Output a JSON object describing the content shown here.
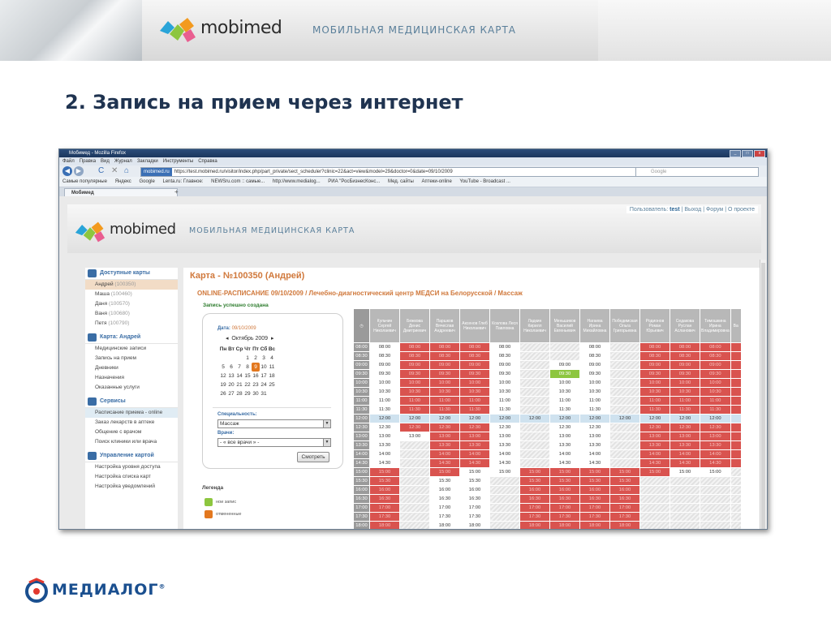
{
  "banner": {
    "brand": "mobimed",
    "tagline": "МОБИЛЬНАЯ МЕДИЦИНСКАЯ КАРТА",
    "logo_icon": "mobimed-logo-icon"
  },
  "slide_title": "2. Запись на прием через интернет",
  "browser": {
    "window_title": "Мобимед - Mozilla Firefox",
    "menu": [
      "Файл",
      "Правка",
      "Вид",
      "Журнал",
      "Закладки",
      "Инструменты",
      "Справка"
    ],
    "url_host": "mobimed.ru",
    "url": "https://test.mobimed.ru/visitor/index.php/part_private/sect_scheduler?clinic=22&act=view&model=29&doctor=0&date=09/10/2009",
    "search_placeholder": "Google",
    "bookmarks": [
      "Самые популярные",
      "Яндекс",
      "Google",
      "Lenta.ru: Главное:",
      "NEWSru.com :: самые...",
      "http://www.medialog...",
      "РИА \"РосБизнесКонс...",
      "Мед. сайты",
      "Аптеки-online",
      "YouTube - Broadcast ..."
    ],
    "tab_title": "Мобимед"
  },
  "site": {
    "brand": "mobimed",
    "tagline": "МОБИЛЬНАЯ МЕДИЦИНСКАЯ КАРТА",
    "userbar": {
      "label": "Пользователь:",
      "user": "test",
      "logout": "Выход",
      "forum": "Форум",
      "about": "О проекте"
    }
  },
  "sidebar": {
    "sections": [
      {
        "title": "Доступные карты",
        "icon": "people-icon",
        "color": "#3a6da5",
        "items": [
          {
            "label": "Андрей",
            "id": "(100350)",
            "active": true
          },
          {
            "label": "Маша",
            "id": "(100460)"
          },
          {
            "label": "Даня",
            "id": "(100570)"
          },
          {
            "label": "Ваня",
            "id": "(100680)"
          },
          {
            "label": "Петя",
            "id": "(100790)"
          }
        ]
      },
      {
        "title": "Карта: Андрей",
        "icon": "card-icon",
        "color": "#3a6da5",
        "items": [
          {
            "label": "Медицинские записи"
          },
          {
            "label": "Запись на прием"
          },
          {
            "label": "Дневники"
          },
          {
            "label": "Назначения"
          },
          {
            "label": "Оказанные услуги"
          }
        ]
      },
      {
        "title": "Сервисы",
        "icon": "info-icon",
        "color": "#3a6da5",
        "items": [
          {
            "label": "Расписание приема - online",
            "active_blue": true
          },
          {
            "label": "Заказ лекарств в аптеке"
          },
          {
            "label": "Общение с врачом"
          },
          {
            "label": "Поиск клиники или врача"
          }
        ]
      },
      {
        "title": "Управление картой",
        "icon": "settings-icon",
        "color": "#3a6da5",
        "items": [
          {
            "label": "Настройка уровня доступа"
          },
          {
            "label": "Настройка списка карт"
          },
          {
            "label": "Настройка уведомлений"
          }
        ]
      }
    ]
  },
  "main": {
    "card_title": "Карта - №100350 (Андрей)",
    "schedule_title": "ONLINE-РАСПИСАНИЕ 09/10/2009 / Лечебно-диагностический центр МЕДСИ на Белорусской / Массаж",
    "success_msg": "Запись успешно создана",
    "calendar": {
      "date_label": "Дата:",
      "date_value": "09/10/2009",
      "month": "Октябрь 2009",
      "weekdays": [
        "Пн",
        "Вт",
        "Ср",
        "Чт",
        "Пт",
        "Сб",
        "Вс"
      ],
      "weeks": [
        [
          "",
          "",
          "",
          "1",
          "2",
          "3",
          "4"
        ],
        [
          "5",
          "6",
          "7",
          "8",
          "9",
          "10",
          "11"
        ],
        [
          "12",
          "13",
          "14",
          "15",
          "16",
          "17",
          "18"
        ],
        [
          "19",
          "20",
          "21",
          "22",
          "23",
          "24",
          "25"
        ],
        [
          "26",
          "27",
          "28",
          "29",
          "30",
          "31",
          ""
        ]
      ],
      "selected": "9"
    },
    "specialty_label": "Специальность:",
    "specialty_value": "Массаж",
    "doctor_label": "Врачи:",
    "doctor_value": "- « все врачи » -",
    "show_button": "Смотреть",
    "legend_title": "Легенда",
    "legend": [
      {
        "label": "нои запис",
        "color": "#8dc63f"
      },
      {
        "label": "отмененные",
        "color": "#e3781f"
      }
    ]
  },
  "schedule": {
    "doctors": [
      "Кульчин Сергей Николаевич",
      "Бежкова Денис Дмитриевич",
      "Паршков Вячеслав Андреевич",
      "Аксенов Глеб Николаевич",
      "Козлова Леся Павловна",
      "Ладкин Кирилл Николаевич",
      "Меньшиков Василий Евгеньевич",
      "Нагаева Ирина Михайловна",
      "Победимская Ольга Григорьевна",
      "Родионов Роман Юрьевич",
      "Седакова Руслан Асланович",
      "Тимошкина Ирина Владимировна",
      "Ва"
    ],
    "times": [
      "08:00",
      "08:30",
      "09:00",
      "09:30",
      "10:00",
      "10:30",
      "11:00",
      "11:30",
      "12:00",
      "12:30",
      "13:00",
      "13:30",
      "14:00",
      "14:30",
      "15:00",
      "15:30",
      "16:00",
      "16:30",
      "17:00",
      "17:30",
      "18:00",
      "18:30"
    ],
    "cells": [
      [
        "f",
        "b",
        "b",
        "b",
        "f",
        "g",
        "g",
        "f",
        "g",
        "b",
        "b",
        "b",
        "b"
      ],
      [
        "f",
        "b",
        "b",
        "b",
        "f",
        "g",
        "g",
        "f",
        "g",
        "b",
        "b",
        "b",
        "b"
      ],
      [
        "f",
        "b",
        "b",
        "b",
        "f",
        "g",
        "f",
        "f",
        "g",
        "b",
        "b",
        "b",
        "b"
      ],
      [
        "f",
        "b",
        "b",
        "b",
        "f",
        "g",
        "gr",
        "f",
        "g",
        "b",
        "b",
        "b",
        "b"
      ],
      [
        "f",
        "b",
        "b",
        "b",
        "f",
        "g",
        "f",
        "f",
        "g",
        "b",
        "b",
        "b",
        "b"
      ],
      [
        "f",
        "b",
        "b",
        "b",
        "f",
        "g",
        "f",
        "f",
        "g",
        "b",
        "b",
        "b",
        "b"
      ],
      [
        "f",
        "b",
        "b",
        "b",
        "f",
        "g",
        "f",
        "f",
        "g",
        "b",
        "b",
        "b",
        "b"
      ],
      [
        "f",
        "b",
        "b",
        "b",
        "f",
        "g",
        "f",
        "f",
        "g",
        "b",
        "b",
        "b",
        "b"
      ],
      [
        "hl",
        "hl",
        "hl",
        "hl",
        "hl",
        "hl",
        "hl",
        "hl",
        "hl",
        "hl",
        "hl",
        "hl",
        "hl"
      ],
      [
        "f",
        "b",
        "b",
        "b",
        "f",
        "g",
        "f",
        "f",
        "g",
        "b",
        "b",
        "b",
        "b"
      ],
      [
        "f",
        "f",
        "b",
        "b",
        "f",
        "g",
        "f",
        "f",
        "g",
        "b",
        "b",
        "b",
        "b"
      ],
      [
        "f",
        "g",
        "b",
        "b",
        "f",
        "g",
        "f",
        "f",
        "g",
        "b",
        "b",
        "b",
        "b"
      ],
      [
        "f",
        "g",
        "b",
        "b",
        "f",
        "g",
        "f",
        "f",
        "g",
        "b",
        "b",
        "b",
        "b"
      ],
      [
        "f",
        "g",
        "b",
        "b",
        "f",
        "g",
        "f",
        "f",
        "g",
        "b",
        "b",
        "b",
        "b"
      ],
      [
        "b",
        "g",
        "b",
        "f",
        "f",
        "b",
        "b",
        "b",
        "b",
        "b",
        "f",
        "f",
        "g"
      ],
      [
        "b",
        "g",
        "f",
        "f",
        "g",
        "b",
        "b",
        "b",
        "b",
        "g",
        "g",
        "g",
        "g"
      ],
      [
        "b",
        "g",
        "f",
        "f",
        "g",
        "b",
        "b",
        "b",
        "b",
        "g",
        "g",
        "g",
        "g"
      ],
      [
        "b",
        "g",
        "f",
        "f",
        "g",
        "b",
        "b",
        "b",
        "b",
        "g",
        "g",
        "g",
        "g"
      ],
      [
        "b",
        "g",
        "f",
        "f",
        "g",
        "b",
        "b",
        "b",
        "b",
        "g",
        "g",
        "g",
        "g"
      ],
      [
        "b",
        "g",
        "f",
        "f",
        "g",
        "b",
        "b",
        "b",
        "b",
        "g",
        "g",
        "g",
        "g"
      ],
      [
        "b",
        "g",
        "f",
        "f",
        "g",
        "b",
        "b",
        "b",
        "b",
        "g",
        "g",
        "g",
        "g"
      ],
      [
        "b",
        "g",
        "f",
        "f",
        "g",
        "b",
        "b",
        "b",
        "b",
        "g",
        "g",
        "g",
        "g"
      ]
    ]
  },
  "footer": {
    "brand": "МЕДИАЛОГ",
    "registered": "®"
  }
}
